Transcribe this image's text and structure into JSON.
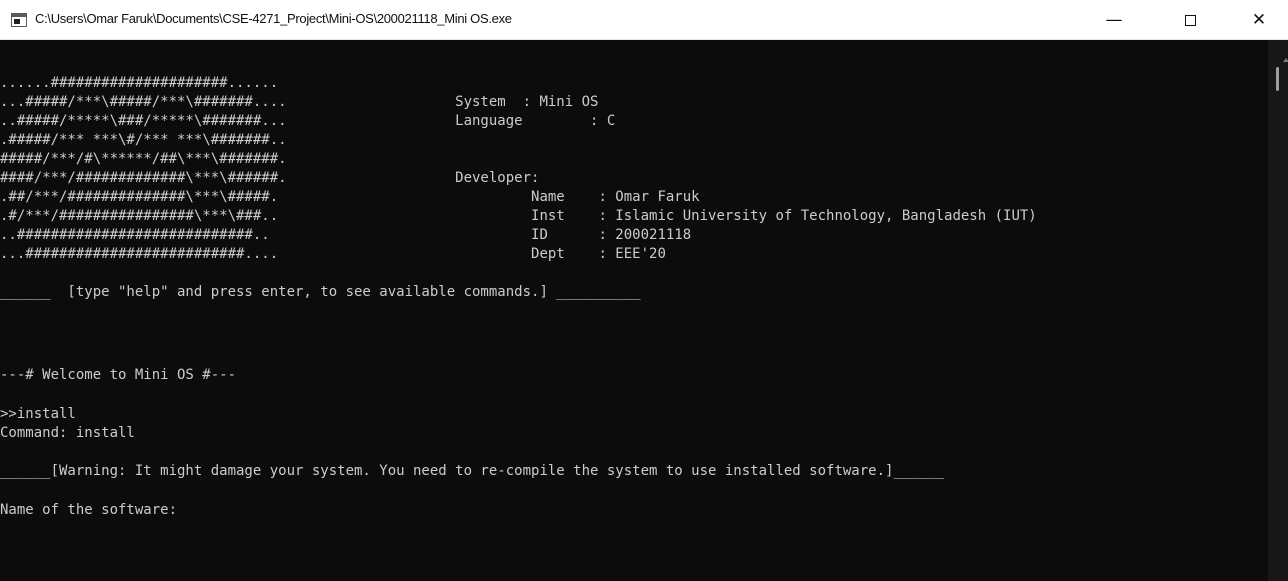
{
  "window": {
    "title": "C:\\Users\\Omar Faruk\\Documents\\CSE-4271_Project\\Mini-OS\\200021118_Mini OS.exe",
    "minimize_label": "—",
    "close_label": "✕"
  },
  "console": {
    "lines": [
      "......#####################......",
      "...#####/***\\#####/***\\#######....                    System  : Mini OS",
      "..#####/*****\\###/*****\\#######...                    Language        : C",
      ".#####/*** ***\\#/*** ***\\#######..",
      "#####/***/#\\******/##\\***\\#######.",
      "####/***/#############\\***\\######.                    Developer:",
      ".##/***/##############\\***\\#####.                              Name    : Omar Faruk",
      ".#/***/################\\***\\###..                              Inst    : Islamic University of Technology, Bangladesh (IUT)",
      "..############################..                               ID      : 200021118",
      "...##########################....                              Dept    : EEE'20",
      "______  [type \"help\" and press enter, to see available commands.] __________",
      "---# Welcome to Mini OS #---",
      ">>install",
      "Command: install",
      "______[Warning: It might damage your system. You need to re-compile the system to use installed software.]______",
      "Name of the software:"
    ]
  }
}
